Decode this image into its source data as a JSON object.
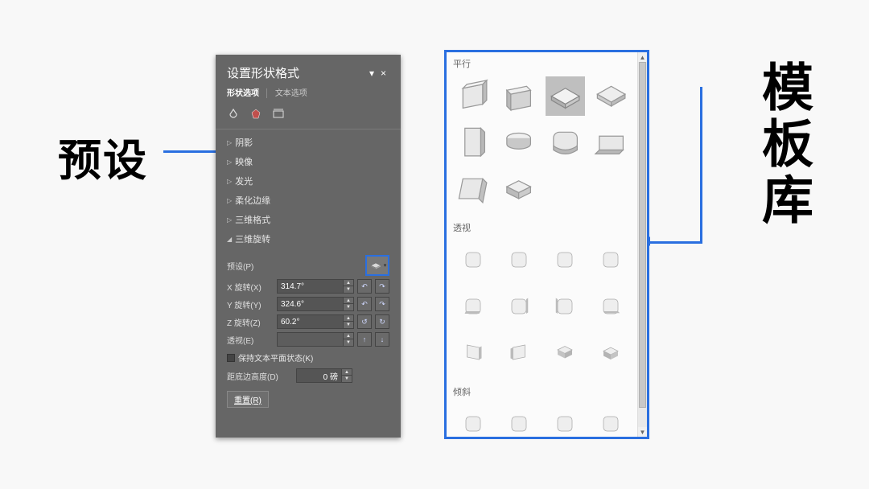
{
  "annotations": {
    "preset_label": "预设",
    "library_label": "模板库"
  },
  "panel": {
    "title": "设置形状格式",
    "close": "×",
    "dropdown": "▾",
    "tabs": {
      "shape_options": "形状选项",
      "text_options": "文本选项"
    },
    "sections": {
      "shadow": "阴影",
      "reflection": "映像",
      "glow": "发光",
      "soft_edges": "柔化边缘",
      "format_3d": "三维格式",
      "rotation_3d": "三维旋转"
    },
    "rotation": {
      "preset_label": "预设(P)",
      "x_label": "X 旋转(X)",
      "y_label": "Y 旋转(Y)",
      "z_label": "Z 旋转(Z)",
      "perspective_label": "透视(E)",
      "x_value": "314.7°",
      "y_value": "324.6°",
      "z_value": "60.2°",
      "perspective_value": "",
      "keep_text_flat": "保持文本平面状态(K)",
      "distance_label": "距底边高度(D)",
      "distance_value": "0 磅",
      "reset": "重置(R)"
    }
  },
  "library": {
    "sections": {
      "parallel": "平行",
      "perspective": "透视",
      "oblique": "倾斜"
    }
  }
}
